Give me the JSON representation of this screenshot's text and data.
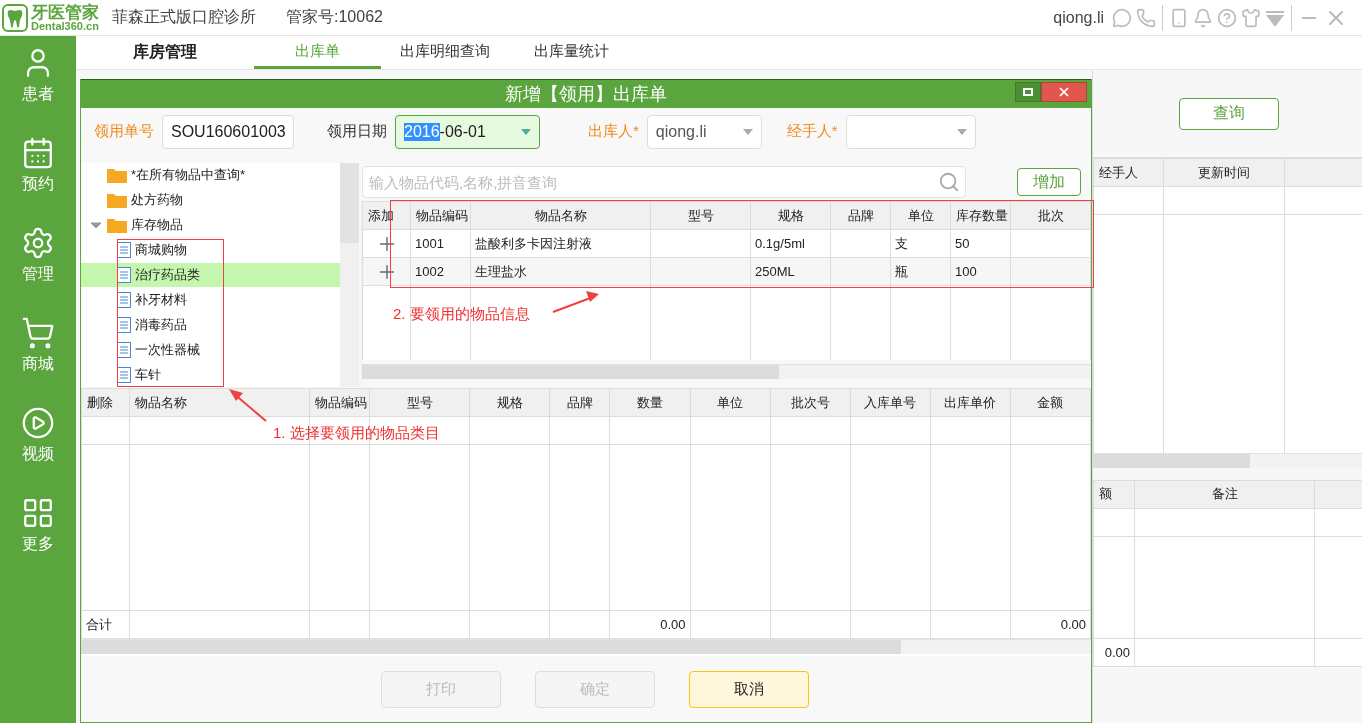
{
  "app": {
    "logo_name": "牙医管家",
    "logo_domain": "Dental360.cn",
    "clinic": "菲森正式版口腔诊所",
    "account_id": "管家号:10062",
    "user": "qiong.li"
  },
  "sidebar": {
    "items": [
      {
        "label": "患者"
      },
      {
        "label": "预约"
      },
      {
        "label": "管理"
      },
      {
        "label": "商城"
      },
      {
        "label": "视频"
      },
      {
        "label": "更多"
      }
    ]
  },
  "module_title": "库房管理",
  "tabs": [
    {
      "label": "出库单",
      "selected": true
    },
    {
      "label": "出库明细查询",
      "selected": false
    },
    {
      "label": "出库量统计",
      "selected": false
    }
  ],
  "background": {
    "query_button": "查询",
    "table_1": {
      "columns": [
        "经手人",
        "更新时间"
      ]
    },
    "table_2": {
      "columns": [
        "额",
        "备注"
      ],
      "total": "0.00"
    }
  },
  "dialog": {
    "title": "新增【领用】出库单",
    "fields": [
      {
        "kind": "text",
        "label": "领用单号",
        "highlighted": true,
        "value": "SOU160601003"
      },
      {
        "kind": "date",
        "label": "领用日期",
        "highlighted": false,
        "value_selected": "2016",
        "value": "-06-01"
      },
      {
        "kind": "select",
        "label": "出库人*",
        "highlighted": true,
        "value": "qiong.li"
      },
      {
        "kind": "select",
        "label": "经手人*",
        "highlighted": true
      }
    ],
    "tree": [
      {
        "kind": "folder",
        "label": "*在所有物品中查询*",
        "selected": false
      },
      {
        "kind": "folder",
        "label": "处方药物",
        "selected": false
      },
      {
        "kind": "folder",
        "label": "库存物品",
        "selected": false,
        "expanded": true,
        "children": [
          {
            "kind": "document",
            "label": "商城购物",
            "selected": false
          },
          {
            "kind": "document",
            "label": "治疗药品类",
            "selected": true
          },
          {
            "kind": "document",
            "label": "补牙材料",
            "selected": false
          },
          {
            "kind": "document",
            "label": "消毒药品",
            "selected": false
          },
          {
            "kind": "document",
            "label": "一次性器械",
            "selected": false
          },
          {
            "kind": "document",
            "label": "车针",
            "selected": false
          }
        ]
      }
    ],
    "search": {
      "placeholder": "输入物品代码,名称,拼音查询"
    },
    "add_button": "增加",
    "stock_table": {
      "columns": [
        "添加",
        "物品编码",
        "物品名称",
        "型号",
        "规格",
        "品牌",
        "单位",
        "库存数量",
        "批次"
      ],
      "rows": [
        {
          "code": "1001",
          "name": "盐酸利多卡因注射液",
          "spec": "0.1g/5ml",
          "unit": "支",
          "stock": "50"
        },
        {
          "code": "1002",
          "name": "生理盐水",
          "spec": "250ML",
          "unit": "瓶",
          "stock": "100"
        }
      ]
    },
    "issue_table": {
      "columns": [
        {
          "label": "删除"
        },
        {
          "label": "物品名称"
        },
        {
          "label": "物品编码"
        },
        {
          "label": "型号"
        },
        {
          "label": "规格"
        },
        {
          "label": "品牌"
        },
        {
          "label": "数量",
          "total": "0.00"
        },
        {
          "label": "单位"
        },
        {
          "label": "批次号"
        },
        {
          "label": "入库单号"
        },
        {
          "label": "出库单价"
        },
        {
          "label": "金额",
          "total": "0.00"
        }
      ],
      "total_label": "合计"
    },
    "buttons": [
      {
        "label": "打印",
        "disabled": true
      },
      {
        "label": "确定",
        "disabled": true
      },
      {
        "label": "取消",
        "disabled": false
      }
    ],
    "annotations": [
      {
        "text": "1. 选择要领用的物品类目"
      },
      {
        "text": "2. 要领用的物品信息"
      }
    ]
  }
}
